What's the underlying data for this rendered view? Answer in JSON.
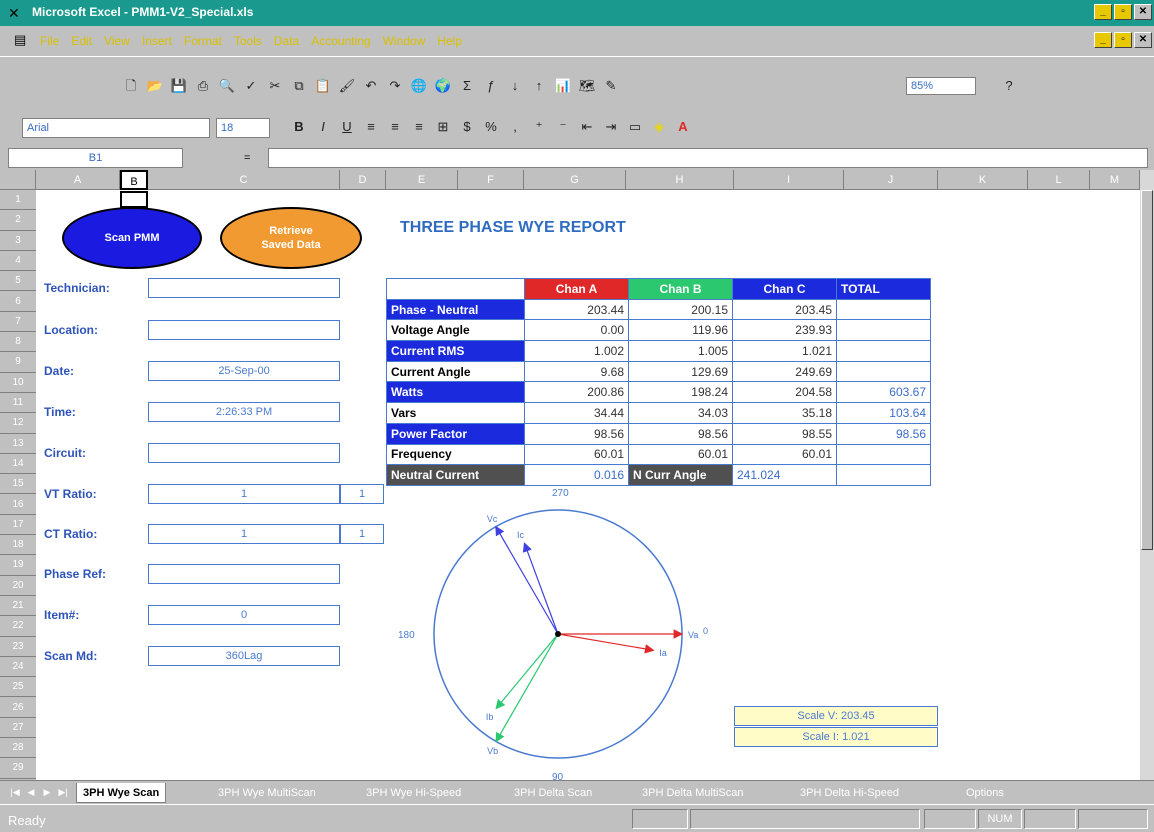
{
  "window": {
    "title": "Microsoft Excel - PMM1-V2_Special.xls"
  },
  "menu": [
    "File",
    "Edit",
    "View",
    "Insert",
    "Format",
    "Tools",
    "Data",
    "Accounting",
    "Window",
    "Help"
  ],
  "toolbar": {
    "zoom": "85%",
    "font": "Arial",
    "size": "18"
  },
  "formula": {
    "cell": "B1",
    "eq": "="
  },
  "columns": [
    "A",
    "B",
    "C",
    "D",
    "E",
    "F",
    "G",
    "H",
    "I",
    "J",
    "K",
    "L",
    "M"
  ],
  "rows": [
    "1",
    "2",
    "3",
    "4",
    "5",
    "6",
    "7",
    "8",
    "9",
    "10",
    "11",
    "12",
    "13",
    "14",
    "15",
    "16",
    "17",
    "18",
    "19",
    "20",
    "21",
    "22",
    "23",
    "24",
    "25",
    "26",
    "27",
    "28",
    "29"
  ],
  "buttons": {
    "scan": "Scan PMM",
    "retrieve1": "Retrieve",
    "retrieve2": "Saved Data"
  },
  "report_title": "THREE PHASE WYE REPORT",
  "fields": {
    "technician": {
      "label": "Technician:",
      "value": ""
    },
    "location": {
      "label": "Location:",
      "value": ""
    },
    "date": {
      "label": "Date:",
      "value": "25-Sep-00"
    },
    "time": {
      "label": "Time:",
      "value": "2:26:33 PM"
    },
    "circuit": {
      "label": "Circuit:",
      "value": ""
    },
    "vt": {
      "label": "VT Ratio:",
      "value": "1",
      "value2": "1"
    },
    "ct": {
      "label": "CT Ratio:",
      "value": "1",
      "value2": "1"
    },
    "phaseref": {
      "label": "Phase Ref:",
      "value": ""
    },
    "item": {
      "label": "Item#:",
      "value": "0"
    },
    "scanmd": {
      "label": "Scan Md:",
      "value": "360Lag"
    }
  },
  "table": {
    "headers": {
      "a": "Chan A",
      "b": "Chan B",
      "c": "Chan C",
      "total": "TOTAL"
    },
    "header_colors": {
      "a": "#e02828",
      "b": "#2cc870",
      "c": "#1a2adc",
      "total": "#1a2adc"
    },
    "rows": [
      {
        "label": "Phase - Neutral",
        "a": "203.44",
        "b": "200.15",
        "c": "203.45",
        "t": ""
      },
      {
        "label": "Voltage Angle",
        "a": "0.00",
        "b": "119.96",
        "c": "239.93",
        "t": ""
      },
      {
        "label": "Current RMS",
        "a": "1.002",
        "b": "1.005",
        "c": "1.021",
        "t": ""
      },
      {
        "label": "Current Angle",
        "a": "9.68",
        "b": "129.69",
        "c": "249.69",
        "t": ""
      },
      {
        "label": "Watts",
        "a": "200.86",
        "b": "198.24",
        "c": "204.58",
        "t": "603.67"
      },
      {
        "label": "Vars",
        "a": "34.44",
        "b": "34.03",
        "c": "35.18",
        "t": "103.64"
      },
      {
        "label": "Power Factor",
        "a": "98.56",
        "b": "98.56",
        "c": "98.55",
        "t": "98.56"
      },
      {
        "label": "Frequency",
        "a": "60.01",
        "b": "60.01",
        "c": "60.01",
        "t": ""
      }
    ],
    "neutral": {
      "label": "Neutral Current",
      "value": "0.016",
      "angle_label": "N Curr Angle",
      "angle": "241.024"
    }
  },
  "phasor": {
    "top": "270",
    "left": "180",
    "right": "0",
    "bottom": "90",
    "va": "Va",
    "ia": "Ia",
    "vb": "Vb",
    "ib": "Ib",
    "vc": "Vc",
    "ic": "Ic"
  },
  "scale": {
    "v": "Scale V:  203.45",
    "i": "Scale  I:  1.021"
  },
  "tabs": [
    "3PH Wye Scan",
    "3PH Wye MultiScan",
    "3PH Wye Hi-Speed",
    "3PH Delta Scan",
    "3PH Delta MultiScan",
    "3PH Delta Hi-Speed",
    "Options"
  ],
  "status": {
    "ready": "Ready",
    "num": "NUM"
  }
}
